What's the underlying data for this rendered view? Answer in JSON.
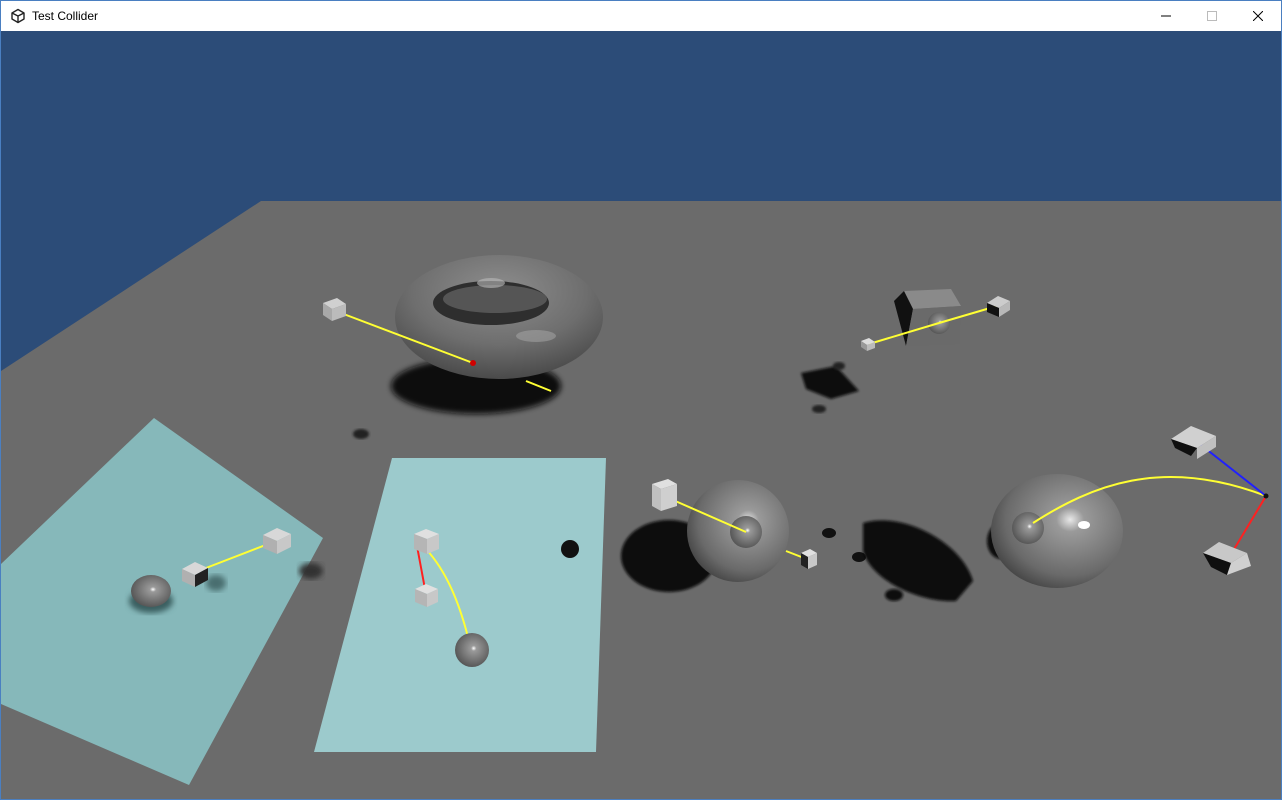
{
  "window": {
    "title": "Test Collider",
    "app_icon": "unity-logo-icon",
    "controls": {
      "minimize_icon": "minimize-icon",
      "maximize_icon": "maximize-icon",
      "close_icon": "close-icon"
    }
  },
  "scene": {
    "colors": {
      "sky": "#2c4c78",
      "ground": "#6b6b6b",
      "trigger_plane": "#9ccacc",
      "joint_line": "#ffff33",
      "axis_red": "#ff2020",
      "axis_blue": "#2020ff"
    }
  }
}
